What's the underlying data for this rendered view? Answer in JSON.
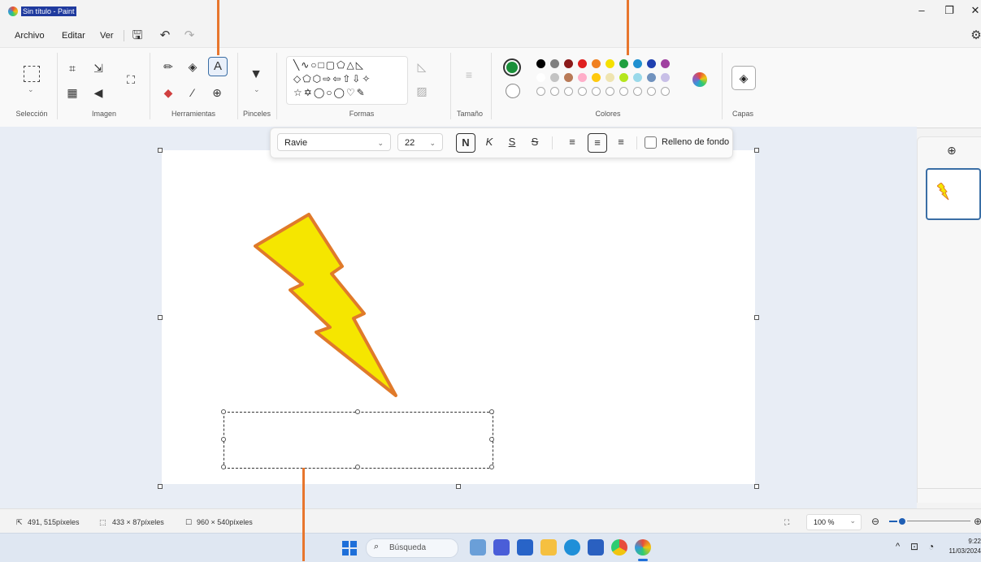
{
  "window": {
    "title": "Sin título - Paint"
  },
  "menu": {
    "items": [
      "Archivo",
      "Editar",
      "Ver"
    ]
  },
  "ribbon": {
    "groups": {
      "seleccion": "Selección",
      "imagen": "Imagen",
      "herramientas": "Herramientas",
      "pinceles": "Pinceles",
      "formas": "Formas",
      "tamano": "Tamaño",
      "colores": "Colores",
      "capas": "Capas"
    },
    "text_tool_glyph": "A",
    "colors": {
      "primary": "#1a8f3a",
      "row1": [
        "#000000",
        "#7f7f7f",
        "#8b1a1a",
        "#e02020",
        "#f08020",
        "#f5e000",
        "#20a040",
        "#2090d0",
        "#2040b0",
        "#a040a0"
      ],
      "row2": [
        "#ffffff",
        "#c3c3c3",
        "#b97a57",
        "#ffaec9",
        "#ffc90e",
        "#efe4b0",
        "#b5e61d",
        "#99d9ea",
        "#7092be",
        "#c8bfe7"
      ]
    }
  },
  "textbar": {
    "font": "Ravie",
    "size": "22",
    "bold": "N",
    "italic": "K",
    "underline": "S",
    "strike": "S",
    "fill_label": "Relleno de fondo"
  },
  "status": {
    "cursor": "491, 515píxeles",
    "selection": "433 × 87píxeles",
    "canvas_size": "960 × 540píxeles",
    "zoom": "100 %"
  },
  "taskbar": {
    "search_placeholder": "Búsqueda",
    "time": "9:22",
    "date": "11/03/2024"
  },
  "accent": {
    "callout": "#e8762d",
    "bolt_fill": "#f5e600",
    "bolt_stroke": "#e07a2a"
  }
}
